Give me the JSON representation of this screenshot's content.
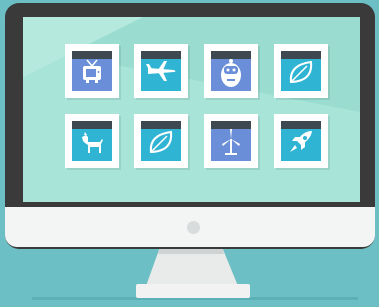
{
  "app_icons": [
    {
      "name": "tv-icon",
      "row": 0,
      "col": 0,
      "tile_color": "#6a8fd8"
    },
    {
      "name": "airplane-icon",
      "row": 0,
      "col": 1,
      "tile_color": "#2fb4d3"
    },
    {
      "name": "robot-icon",
      "row": 0,
      "col": 2,
      "tile_color": "#6a8fd8"
    },
    {
      "name": "leaf-icon",
      "row": 0,
      "col": 3,
      "tile_color": "#2fb4d3"
    },
    {
      "name": "dog-icon",
      "row": 1,
      "col": 0,
      "tile_color": "#2fb4d3"
    },
    {
      "name": "leaf-icon",
      "row": 1,
      "col": 1,
      "tile_color": "#2fb4d3"
    },
    {
      "name": "wind-turbine-icon",
      "row": 1,
      "col": 2,
      "tile_color": "#6a8fd8"
    },
    {
      "name": "rocket-icon",
      "row": 1,
      "col": 3,
      "tile_color": "#2fb4d3"
    }
  ],
  "colors": {
    "background": "#6cbfc4",
    "screen": "#a8e4d8",
    "bezel": "#3a3a3a",
    "chin": "#f3f4f4"
  }
}
